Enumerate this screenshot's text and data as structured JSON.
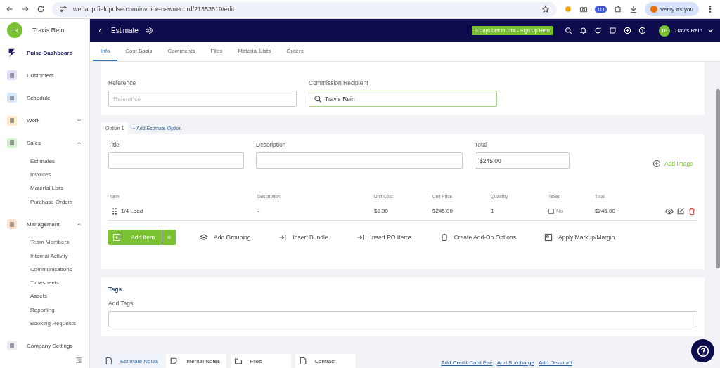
{
  "browser": {
    "url": "webapp.fieldpulse.com/invoice-new/record/21353510/edit",
    "badge": "111",
    "verify_button": "Verify it's you"
  },
  "sidebar": {
    "user": {
      "initials": "TR",
      "name": "Travis Rein"
    },
    "items": [
      {
        "label": "Pulse Dashboard",
        "selected": true
      },
      {
        "label": "Customers",
        "selected": false,
        "color": "#e6dcfa"
      },
      {
        "label": "Schedule",
        "selected": false,
        "color": "#d8e8fb"
      },
      {
        "label": "Work",
        "selected": false,
        "color": "#fcebcb",
        "expanded": false
      },
      {
        "label": "Sales",
        "selected": false,
        "color": "#d7efd3",
        "expanded": true,
        "children": [
          {
            "label": "Estimates"
          },
          {
            "label": "Invoices"
          },
          {
            "label": "Material Lists"
          },
          {
            "label": "Purchase Orders"
          }
        ]
      },
      {
        "label": "Management",
        "selected": false,
        "color": "#fde2d0",
        "expanded": true,
        "children": [
          {
            "label": "Team Members"
          },
          {
            "label": "Internal Activity"
          },
          {
            "label": "Communications"
          },
          {
            "label": "Timesheets"
          },
          {
            "label": "Assets"
          },
          {
            "label": "Reporting"
          },
          {
            "label": "Booking Requests"
          }
        ]
      },
      {
        "label": "Company Settings",
        "selected": false,
        "color": "#eceef6"
      }
    ]
  },
  "header": {
    "title": "Estimate",
    "trial_badge": "3 Days Left in Trial - Sign Up Here",
    "user": {
      "initials": "TR",
      "name": "Travis Rein"
    }
  },
  "tabs": [
    {
      "label": "Info",
      "selected": true
    },
    {
      "label": "Cost Basis",
      "selected": false
    },
    {
      "label": "Comments",
      "selected": false
    },
    {
      "label": "Files",
      "selected": false
    },
    {
      "label": "Material Lists",
      "selected": false
    },
    {
      "label": "Orders",
      "selected": false
    }
  ],
  "reference": {
    "label": "Reference",
    "placeholder": "Reference"
  },
  "commission": {
    "label": "Commission Recipient",
    "value": "Travis Rein"
  },
  "options": [
    {
      "label": "Option 1",
      "selected": true
    }
  ],
  "add_option": "+ Add Estimate Option",
  "option_fields": {
    "title_label": "Title",
    "description_label": "Description",
    "total_label": "Total",
    "total_value": "$245.00",
    "add_image": "Add Image"
  },
  "table": {
    "columns": [
      "Item",
      "Description",
      "Unit Cost",
      "Unit Price",
      "Quantity",
      "Taxed",
      "Total"
    ],
    "rows": [
      {
        "item": "1/4 Load",
        "description": "-",
        "unit_cost": "$0.00",
        "unit_price": "$245.00",
        "quantity": "1",
        "taxed": {
          "checked": false,
          "label": "No"
        },
        "total": "$245.00"
      }
    ]
  },
  "add_item": "Add Item",
  "tools": [
    "Add Grouping",
    "Insert Bundle",
    "Insert PO Items",
    "Create Add-On Options",
    "Apply Markup/Margin"
  ],
  "tags": {
    "heading": "Tags",
    "label": "Add Tags"
  },
  "bottom_tabs": [
    {
      "label": "Estimate Notes",
      "selected": true
    },
    {
      "label": "Internal Notes",
      "selected": false
    },
    {
      "label": "Files",
      "selected": false
    },
    {
      "label": "Contract",
      "selected": false
    }
  ],
  "links": [
    "Add Credit Card Fee",
    "Add Surcharge",
    "Add Discount"
  ]
}
